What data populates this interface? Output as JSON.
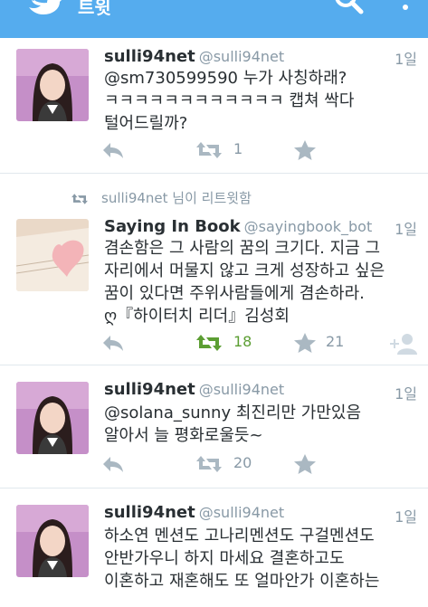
{
  "header": {
    "title": "트윗"
  },
  "tweets": [
    {
      "name": "sulli94net",
      "handle": "@sulli94net",
      "time": "1일",
      "lines": [
        "@sm730599590 누가 사칭하래?",
        "ㅋㅋㅋㅋㅋㅋㅋㅋㅋㅋㅋㅋ 캡쳐 싹다",
        "털어드릴까?"
      ],
      "retweets": "1",
      "favorites": ""
    },
    {
      "retweeted_by": "sulli94net 님이 리트윗함",
      "name": "Saying In Book",
      "handle": "@sayingbook_bot",
      "time": "1일",
      "lines": [
        "겸손함은 그 사람의 꿈의 크기다. 지금 그",
        "자리에서 머물지 않고 크게 성장하고 싶은",
        "꿈이 있다면 주위사람들에게 겸손하라.",
        "ღ『하이터치 리더』김성회"
      ],
      "retweets": "18",
      "favorites": "21"
    },
    {
      "name": "sulli94net",
      "handle": "@sulli94net",
      "time": "1일",
      "lines": [
        "@solana_sunny 최진리만 가만있음",
        "알아서 늘 평화로울듯~"
      ],
      "retweets": "20",
      "favorites": ""
    },
    {
      "name": "sulli94net",
      "handle": "@sulli94net",
      "time": "1일",
      "lines": [
        "하소연 멘션도 고나리멘션도 구걸멘션도",
        "안반가우니 하지 마세요 결혼하고도",
        "이혼하고 재혼해도 또 얼마안가 이혼하는"
      ]
    }
  ],
  "colors": {
    "brand": "#55acee",
    "retweet_active": "#5c9e33",
    "muted": "#8899a6"
  }
}
